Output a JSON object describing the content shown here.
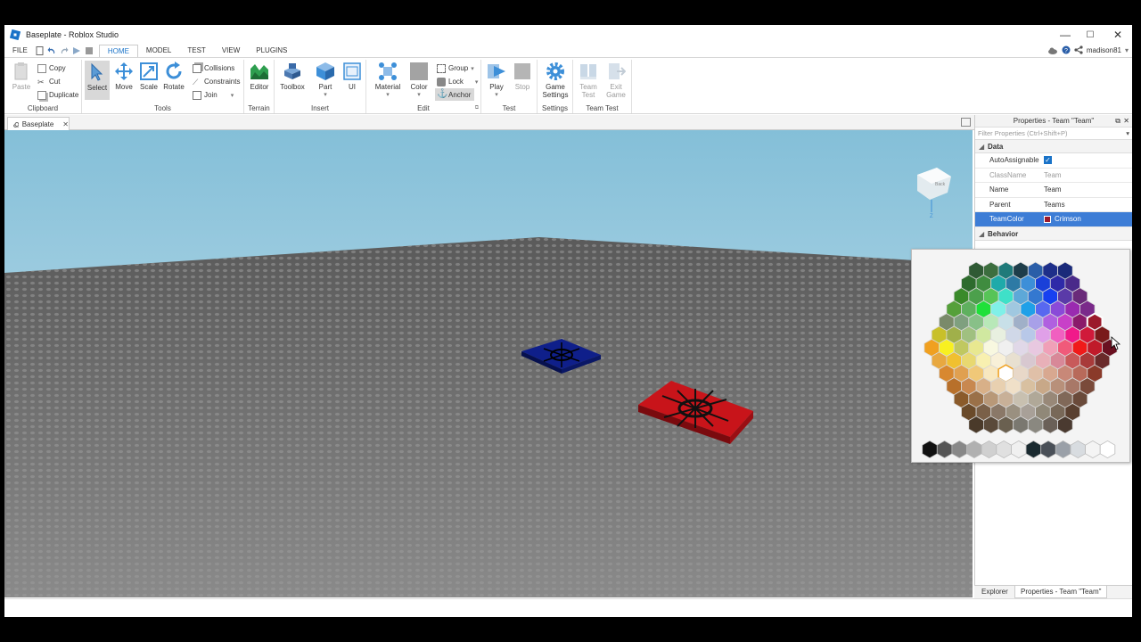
{
  "window": {
    "title": "Baseplate - Roblox Studio",
    "min": "—",
    "max": "☐",
    "close": "✕"
  },
  "menu": {
    "tabs": [
      "FILE",
      "HOME",
      "MODEL",
      "TEST",
      "VIEW",
      "PLUGINS"
    ],
    "active": "HOME"
  },
  "user": {
    "name": "madison81"
  },
  "ribbon": {
    "clipboard": {
      "paste": "Paste",
      "copy": "Copy",
      "cut": "Cut",
      "duplicate": "Duplicate",
      "group": "Clipboard"
    },
    "tools": {
      "select": "Select",
      "move": "Move",
      "scale": "Scale",
      "rotate": "Rotate",
      "collisions": "Collisions",
      "constraints": "Constraints",
      "join": "Join",
      "group": "Tools"
    },
    "terrain": {
      "editor": "Editor",
      "group": "Terrain"
    },
    "insert": {
      "toolbox": "Toolbox",
      "part": "Part",
      "ui": "UI",
      "group": "Insert"
    },
    "edit": {
      "material": "Material",
      "color": "Color",
      "group_btn": "Group",
      "lock": "Lock",
      "anchor": "Anchor",
      "group": "Edit"
    },
    "test": {
      "play": "Play",
      "stop": "Stop",
      "group": "Test"
    },
    "settings": {
      "game_settings_1": "Game",
      "game_settings_2": "Settings",
      "group": "Settings"
    },
    "team_test": {
      "team_test_1": "Team",
      "team_test_2": "Test",
      "exit_game_1": "Exit",
      "exit_game_2": "Game",
      "group": "Team Test"
    }
  },
  "doc_tab": {
    "label": "Baseplate"
  },
  "properties": {
    "header": "Properties - Team \"Team\"",
    "filter_placeholder": "Filter Properties (Ctrl+Shift+P)",
    "categories": {
      "data": "Data",
      "behavior": "Behavior"
    },
    "rows": [
      {
        "key": "AutoAssignable",
        "value": "",
        "checked": true
      },
      {
        "key": "ClassName",
        "value": "Team"
      },
      {
        "key": "Name",
        "value": "Team"
      },
      {
        "key": "Parent",
        "value": "Teams"
      },
      {
        "key": "TeamColor",
        "value": "Crimson",
        "swatch": "#9b1a2b"
      }
    ]
  },
  "bottom_tabs": {
    "explorer": "Explorer",
    "properties": "Properties - Team \"Team\""
  },
  "colors": {
    "accent": "#1a73c8",
    "selection": "#3d7dd6",
    "sky_top": "#84bfd8",
    "sky_bottom": "#c9e3ef",
    "ground": "#747474",
    "blue_pad": "#0f1f8a",
    "red_pad": "#c8141a"
  }
}
